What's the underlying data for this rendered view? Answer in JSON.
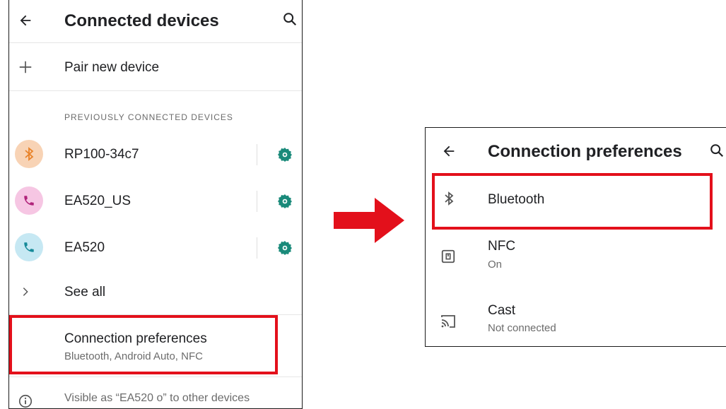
{
  "left": {
    "title": "Connected devices",
    "pair_label": "Pair new device",
    "section_header": "PREVIOUSLY CONNECTED DEVICES",
    "devices": [
      {
        "name": "RP100-34c7",
        "icon": "bluetooth-icon",
        "color": "#f8d3b5",
        "glyph_color": "#e8832a"
      },
      {
        "name": "EA520_US",
        "icon": "phone-icon",
        "color": "#f6c6e3",
        "glyph_color": "#b0237a"
      },
      {
        "name": "EA520",
        "icon": "phone-icon",
        "color": "#c6e8f3",
        "glyph_color": "#168a99"
      }
    ],
    "see_all": "See all",
    "connection_prefs_title": "Connection preferences",
    "connection_prefs_sub": "Bluetooth, Android Auto, NFC",
    "visible_as": "Visible as “EA520 o” to other devices"
  },
  "right": {
    "title": "Connection preferences",
    "items": [
      {
        "label": "Bluetooth",
        "sub": "",
        "icon": "bluetooth-icon"
      },
      {
        "label": "NFC",
        "sub": "On",
        "icon": "nfc-icon"
      },
      {
        "label": "Cast",
        "sub": "Not connected",
        "icon": "cast-icon"
      }
    ]
  },
  "colors": {
    "accent": "#1a8a7a",
    "highlight": "#e3101b",
    "arrow": "#e3101b"
  }
}
